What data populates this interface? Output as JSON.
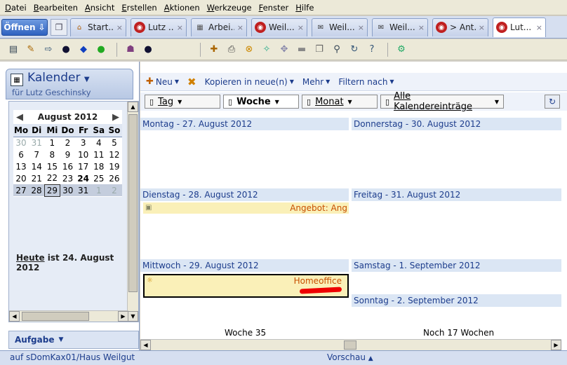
{
  "menu": [
    "Datei",
    "Bearbeiten",
    "Ansicht",
    "Erstellen",
    "Aktionen",
    "Werkzeuge",
    "Fenster",
    "Hilfe"
  ],
  "tabbar": {
    "open_label": "Öffnen",
    "tabs": [
      {
        "label": "Start...",
        "icon": "home-icon"
      },
      {
        "label": "Lutz ...",
        "icon": "notes-icon"
      },
      {
        "label": "Arbei...",
        "icon": "workspace-icon"
      },
      {
        "label": "Weil...",
        "icon": "notes-icon"
      },
      {
        "label": "Weil...",
        "icon": "mail-icon"
      },
      {
        "label": "Weil...",
        "icon": "mail-icon"
      },
      {
        "label": "> Ant...",
        "icon": "notes-icon"
      },
      {
        "label": "Lut...",
        "icon": "notes-icon"
      }
    ],
    "close_glyph": "×"
  },
  "sidebar": {
    "title": "Kalender",
    "subtitle": "für Lutz Geschinsky",
    "month_label": "August  2012",
    "weekdays": [
      "Mo",
      "Di",
      "Mi",
      "Do",
      "Fr",
      "Sa",
      "So"
    ],
    "weeks": [
      [
        "30",
        "31",
        "1",
        "2",
        "3",
        "4",
        "5"
      ],
      [
        "6",
        "7",
        "8",
        "9",
        "10",
        "11",
        "12"
      ],
      [
        "13",
        "14",
        "15",
        "16",
        "17",
        "18",
        "19"
      ],
      [
        "20",
        "21",
        "22",
        "23",
        "24",
        "25",
        "26"
      ],
      [
        "27",
        "28",
        "29",
        "30",
        "31",
        "1",
        "2"
      ]
    ],
    "today_link": "Heute",
    "today_text": " ist 24. August 2012",
    "tasks_label": "Aufgabe"
  },
  "actions": {
    "new": "Neu",
    "copy": "Kopieren in neue(n)",
    "more": "Mehr",
    "filter": "Filtern nach"
  },
  "views": {
    "day": "Tag",
    "week": "Woche",
    "month": "Monat",
    "all": "Alle Kalendereinträge"
  },
  "days": {
    "mon": "Montag - 27. August 2012",
    "tue": "Dienstag - 28. August 2012",
    "wed": "Mittwoch - 29. August 2012",
    "thu": "Donnerstag - 30. August 2012",
    "fri": "Freitag - 31. August 2012",
    "sat": "Samstag - 1. September 2012",
    "sun": "Sonntag - 2. September 2012"
  },
  "appointments": {
    "tue": "Angebot: Ang",
    "wed": "Homeoffice"
  },
  "footer": {
    "week_label": "Woche 35",
    "remaining_label": "Noch 17 Wochen"
  },
  "status": {
    "location": "auf sDomKax01/Haus Weilgut",
    "preview": "Vorschau"
  }
}
